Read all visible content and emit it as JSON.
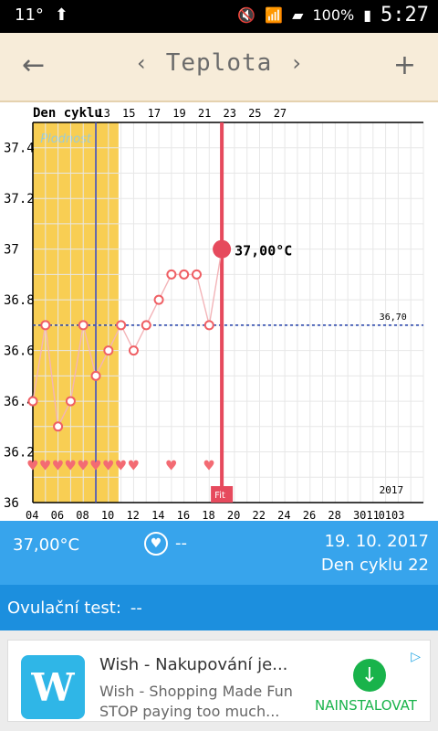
{
  "status_bar": {
    "left_text": "11°",
    "right_text": "100%",
    "clock": "5:27"
  },
  "app_bar": {
    "back_label": "←",
    "prev_label": "‹",
    "title": "Teplota",
    "next_label": "›",
    "add_label": "+"
  },
  "chart_data": {
    "type": "line",
    "title": "",
    "legend": [],
    "axis": {
      "x": {
        "top_label": "Den cyklu",
        "top_ticks": [
          "13",
          "15",
          "17",
          "19",
          "21",
          "23",
          "25",
          "27"
        ],
        "bottom_ticks": [
          "04",
          "06",
          "08",
          "10",
          "12",
          "14",
          "16",
          "18",
          "20",
          "22",
          "24",
          "26",
          "28",
          "3011",
          "0103"
        ],
        "bottom_note": "2017",
        "range": [
          0,
          31
        ]
      },
      "y": {
        "ticks": [
          "37.4",
          "37.2",
          "37",
          "36.8",
          "36.6",
          "36.4",
          "36.2",
          "36"
        ],
        "range": [
          36.0,
          37.5
        ]
      }
    },
    "fertility_window": {
      "label": "Plodnost",
      "start_x": 0.0,
      "end_x": 6.8,
      "color": "#f7c940"
    },
    "vertical_blue_line_x": 5.0,
    "horizontal_reference": {
      "value": 36.7,
      "label": "36,70"
    },
    "selected": {
      "x": 15.0,
      "y": 37.0,
      "label": "37,00°C",
      "tag": "Fit"
    },
    "series": [
      {
        "color": "#ef5f64",
        "points": [
          {
            "x": 0,
            "y": 36.4
          },
          {
            "x": 1,
            "y": 36.7
          },
          {
            "x": 2,
            "y": 36.3
          },
          {
            "x": 3,
            "y": 36.4
          },
          {
            "x": 4,
            "y": 36.7
          },
          {
            "x": 5,
            "y": 36.5
          },
          {
            "x": 6,
            "y": 36.6
          },
          {
            "x": 7,
            "y": 36.7
          },
          {
            "x": 8,
            "y": 36.6
          },
          {
            "x": 9,
            "y": 36.7
          },
          {
            "x": 10,
            "y": 36.8
          },
          {
            "x": 11,
            "y": 36.9
          },
          {
            "x": 12,
            "y": 36.9
          },
          {
            "x": 13,
            "y": 36.9
          },
          {
            "x": 14,
            "y": 36.7
          },
          {
            "x": 15,
            "y": 37.0
          }
        ]
      }
    ],
    "hearts": [
      0,
      1,
      2,
      3,
      4,
      5,
      6,
      7,
      8,
      11,
      14
    ],
    "heart_y": 36.15
  },
  "summary": {
    "temp": "37,00°C",
    "heart_val": "--",
    "date": "19. 10. 2017",
    "cycle_day": "Den cyklu 22"
  },
  "ovulation": {
    "label": "Ovulační test:",
    "value": "--"
  },
  "ad": {
    "logo_text": "W",
    "title": "Wish - Nakupování je...",
    "line1": "Wish - Shopping Made Fun",
    "line2": "STOP paying too much...",
    "install_label": "NAINSTALOVAT"
  }
}
